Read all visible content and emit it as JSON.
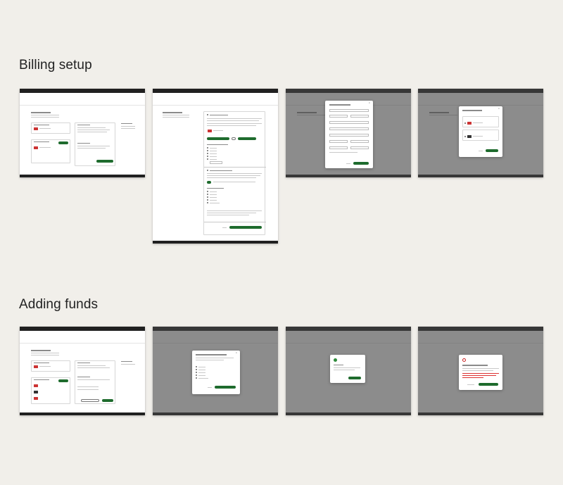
{
  "sections": {
    "billing_setup_title": "Billing setup",
    "adding_funds_title": "Adding funds"
  },
  "colors": {
    "page_background": "#f1efea",
    "topbar": "#202020",
    "primary_button": "#1e6b2d",
    "modal_overlay": "#464646",
    "error": "#d33333",
    "success": "#2e8b3b"
  },
  "icons": {
    "close": "close-icon",
    "success": "check-circle-icon",
    "error": "error-circle-icon",
    "card": "credit-card-icon"
  }
}
